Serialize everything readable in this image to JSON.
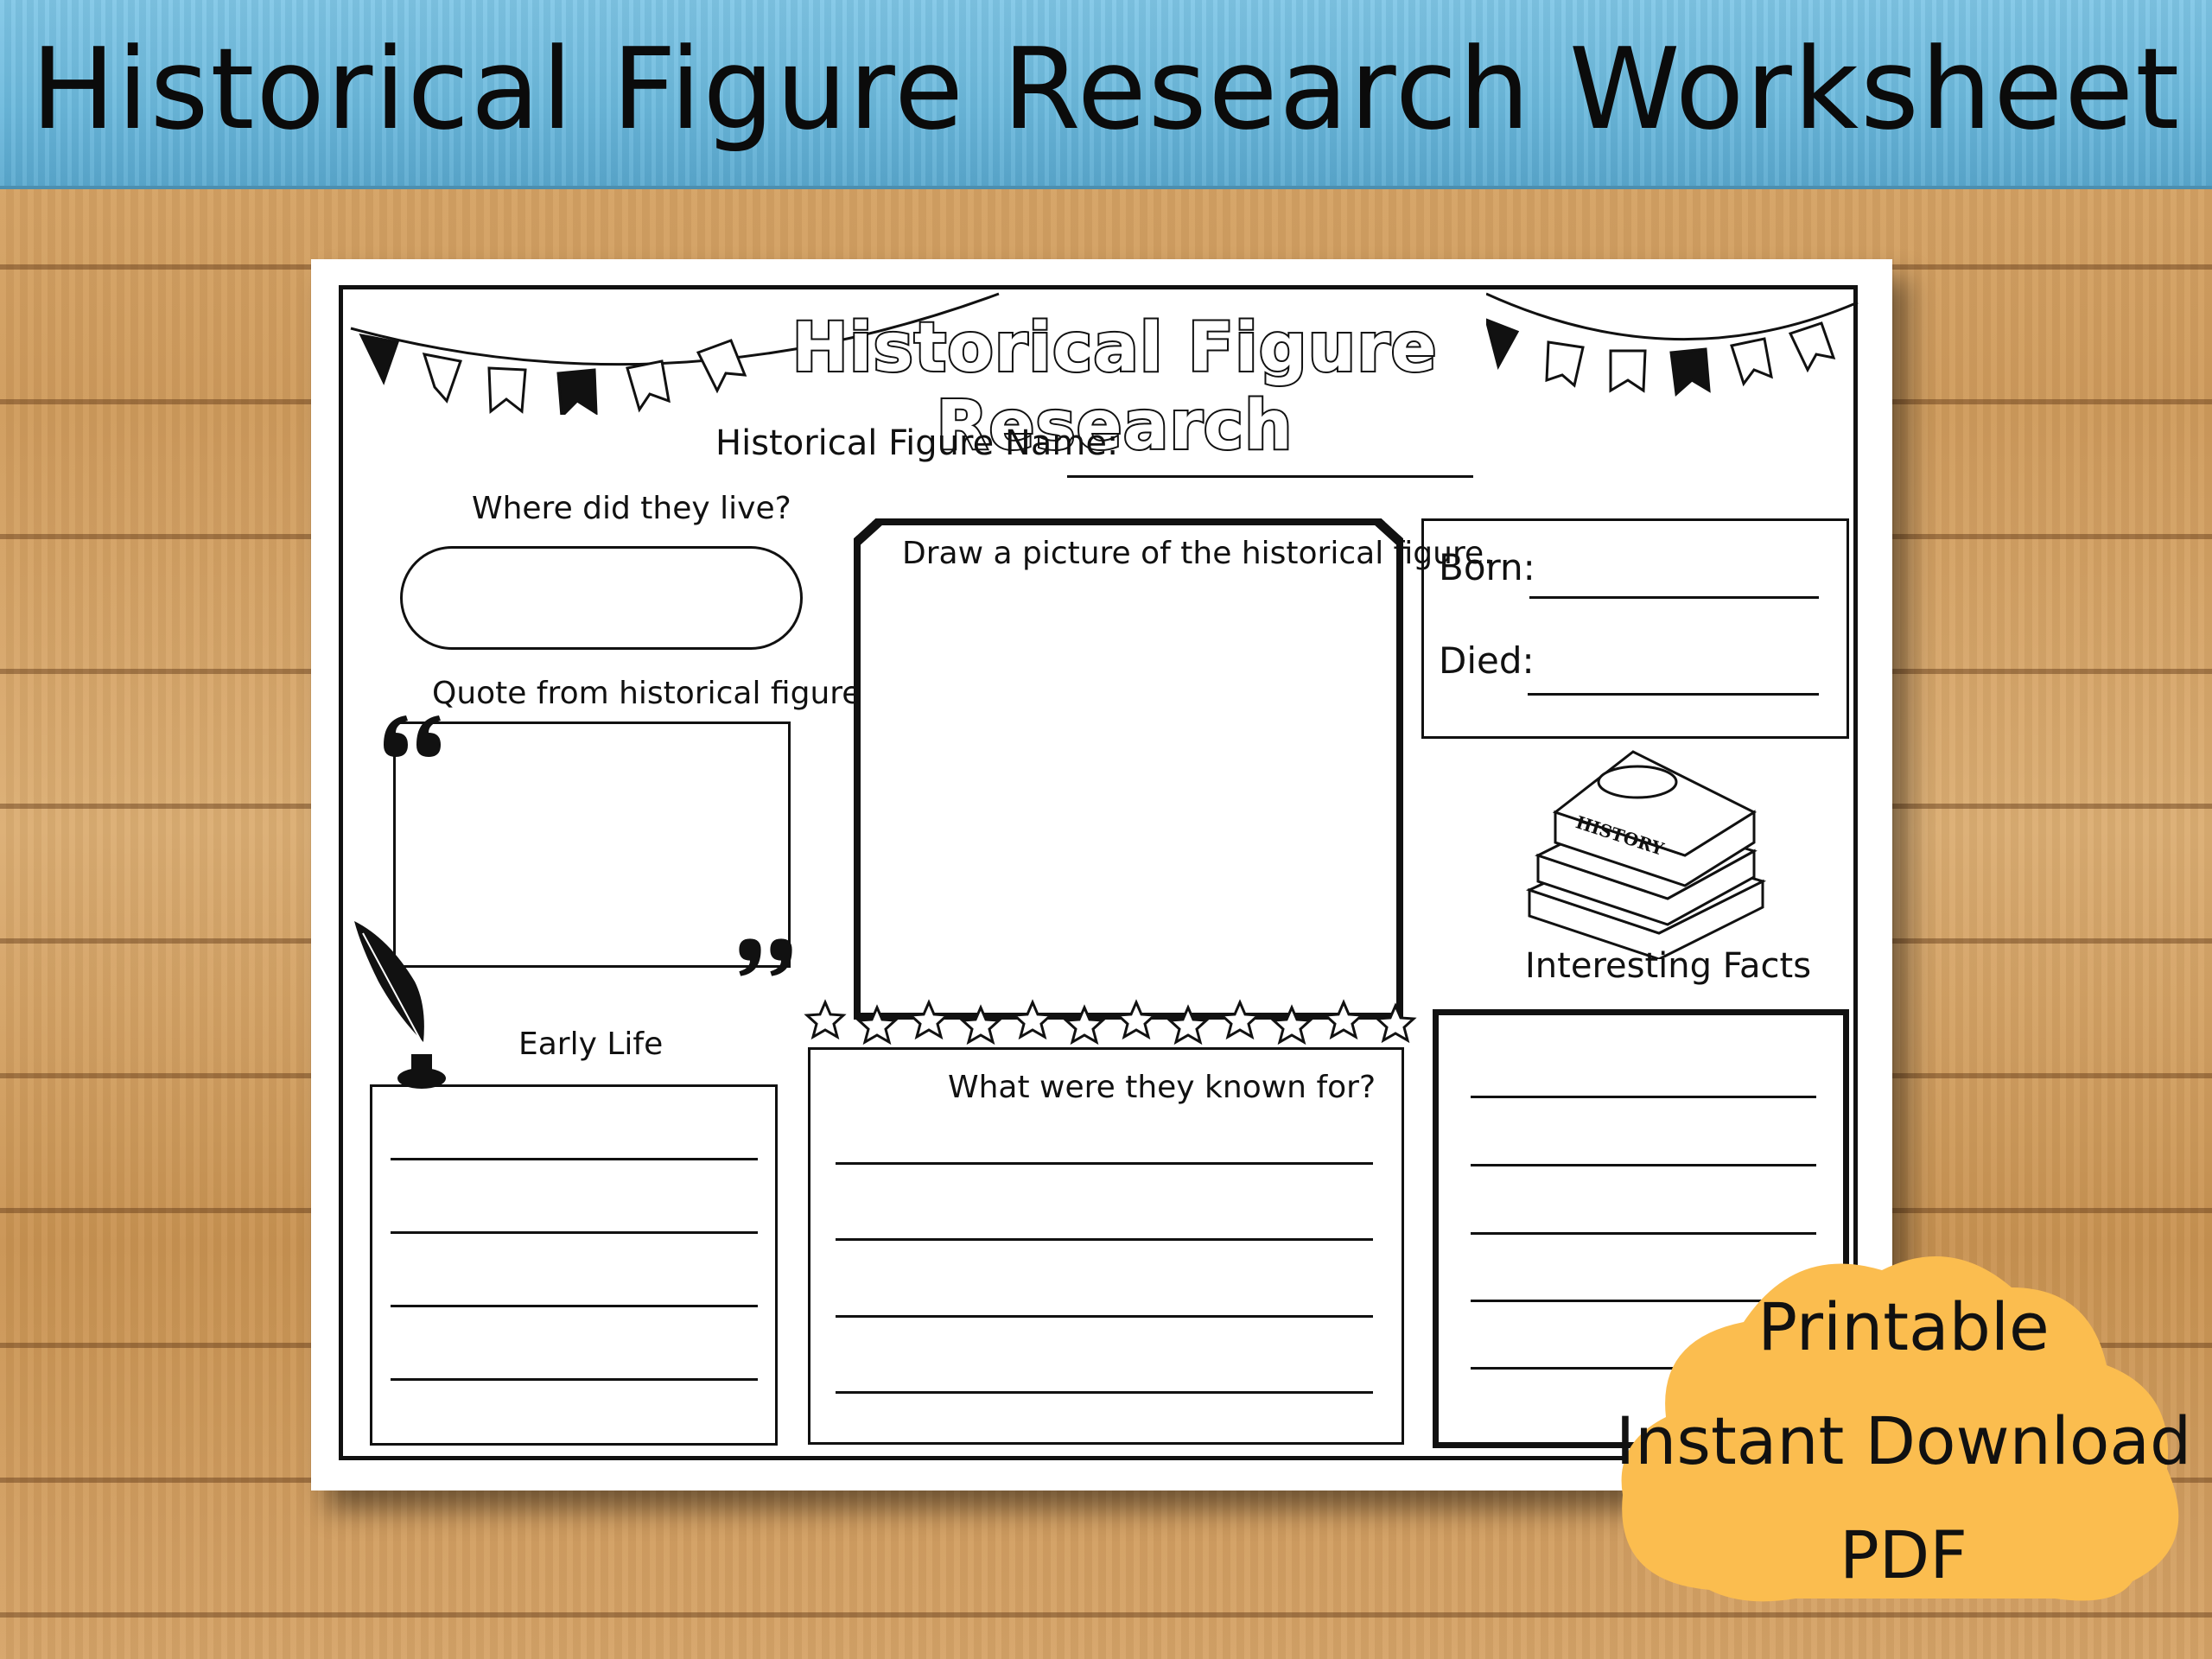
{
  "banner": {
    "title": "Historical Figure Research Worksheet"
  },
  "sheet": {
    "title": "Historical Figure Research",
    "name_label": "Historical Figure Name:",
    "where_label": "Where did they live?",
    "quote_label": "Quote from historical figure",
    "draw_label": "Draw a picture of the historical figure.",
    "born_label": "Born:",
    "died_label": "Died:",
    "history_book_label": "HISTORY",
    "facts_label": "Interesting Facts",
    "early_life_label": "Early Life",
    "known_for_label": "What were they known for?"
  },
  "promo": {
    "line1": "Printable",
    "line2": "Instant Download",
    "line3": "PDF",
    "color": "#fbbd4f"
  },
  "colors": {
    "banner": "#6ab8dc",
    "wood": "#d3a166",
    "ink": "#111111"
  }
}
